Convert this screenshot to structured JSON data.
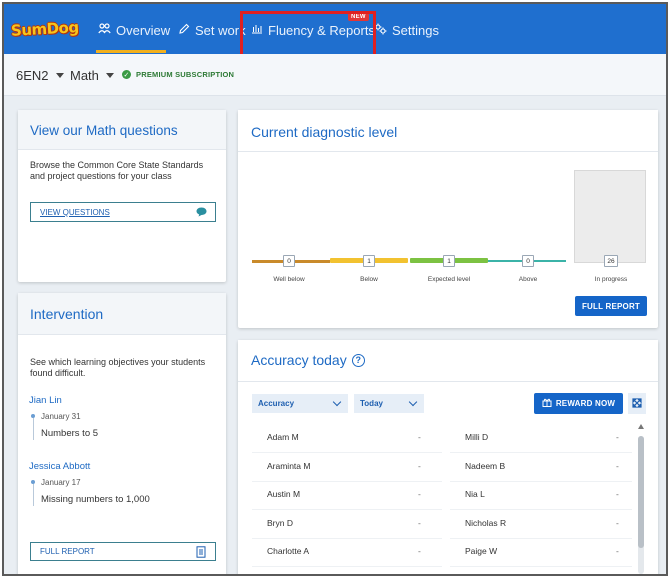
{
  "nav": {
    "logo": "SumDog",
    "items": [
      {
        "label": "Overview",
        "icon": "group-icon"
      },
      {
        "label": "Set work",
        "icon": "pencil-icon"
      },
      {
        "label": "Fluency & Reports",
        "icon": "bar-chart-icon"
      },
      {
        "label": "Settings",
        "icon": "gear-icon"
      }
    ],
    "new_badge": "NEW"
  },
  "subbar": {
    "class_name": "6EN2",
    "subject": "Math",
    "premium": "PREMIUM SUBSCRIPTION"
  },
  "math_card": {
    "title": "View our Math questions",
    "description": "Browse the Common Core State Standards and project questions for your class",
    "button": "VIEW QUESTIONS"
  },
  "intervention": {
    "title": "Intervention",
    "description": "See which learning objectives your students found difficult.",
    "students": [
      {
        "name": "Jian Lin",
        "date": "January 31",
        "objective": "Numbers to 5"
      },
      {
        "name": "Jessica Abbott",
        "date": "January 17",
        "objective": "Missing numbers to 1,000"
      }
    ],
    "button": "FULL REPORT"
  },
  "diagnostic": {
    "title": "Current diagnostic level",
    "levels": [
      {
        "label": "Well below",
        "count": "0",
        "color": "#c98a2a"
      },
      {
        "label": "Below",
        "count": "1",
        "color": "#f2c230"
      },
      {
        "label": "Expected level",
        "count": "1",
        "color": "#7cc242"
      },
      {
        "label": "Above",
        "count": "0",
        "color": "#3bb3a8"
      },
      {
        "label": "In progress",
        "count": "26"
      }
    ],
    "button": "FULL REPORT"
  },
  "accuracy": {
    "title": "Accuracy today",
    "filter_metric": "Accuracy",
    "filter_period": "Today",
    "reward_button": "REWARD NOW",
    "students_left": [
      {
        "name": "Adam M",
        "value": "-"
      },
      {
        "name": "Araminta M",
        "value": "-"
      },
      {
        "name": "Austin M",
        "value": "-"
      },
      {
        "name": "Bryn D",
        "value": "-"
      },
      {
        "name": "Charlotte A",
        "value": "-"
      }
    ],
    "students_right": [
      {
        "name": "Milli D",
        "value": "-"
      },
      {
        "name": "Nadeem B",
        "value": "-"
      },
      {
        "name": "Nia L",
        "value": "-"
      },
      {
        "name": "Nicholas R",
        "value": "-"
      },
      {
        "name": "Paige W",
        "value": "-"
      }
    ]
  }
}
